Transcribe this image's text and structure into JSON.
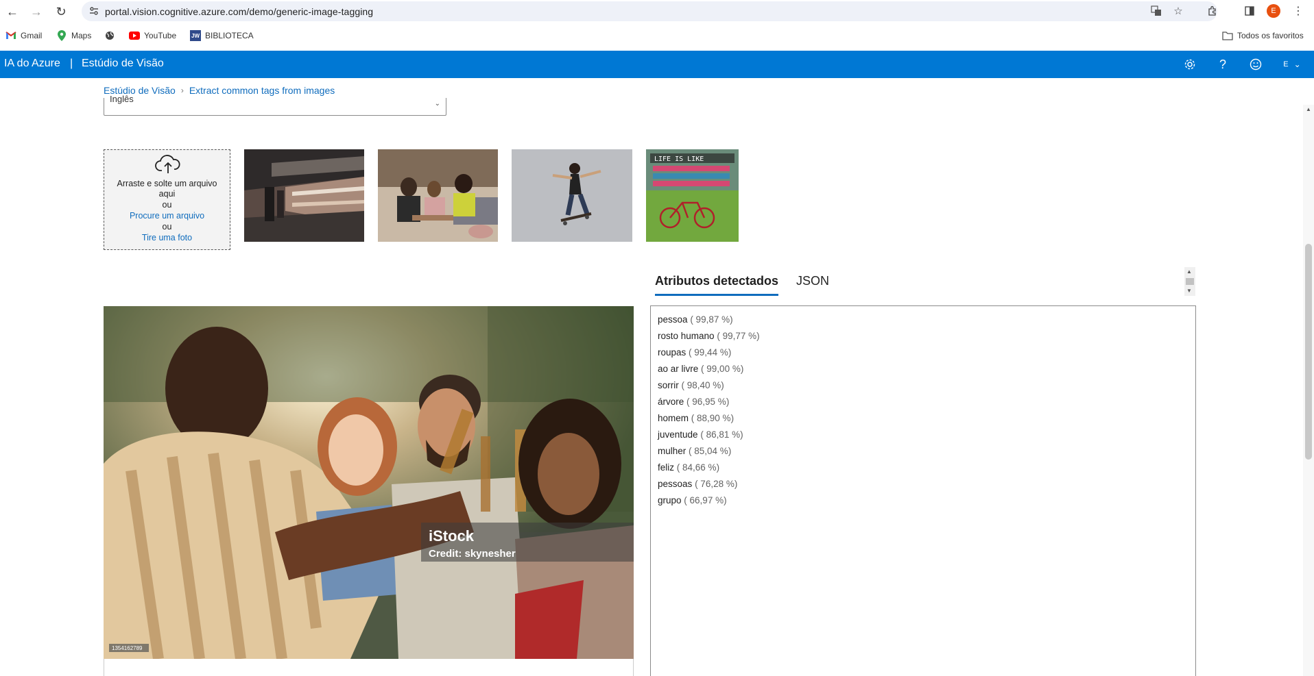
{
  "browser": {
    "url": "portal.vision.cognitive.azure.com/demo/generic-image-tagging",
    "profile_initial": "E",
    "bookmarks": [
      "Gmail",
      "Maps",
      "YouTube",
      "BIBLIOTECA"
    ],
    "all_bookmarks_label": "Todos os favoritos"
  },
  "header": {
    "brand": "IA do Azure",
    "separator": "|",
    "studio": "Estúdio de Visão",
    "user_initial": "E"
  },
  "breadcrumb": {
    "home": "Estúdio de Visão",
    "current": "Extract common tags from images"
  },
  "language_select": {
    "value": "Inglês"
  },
  "dropzone": {
    "line1": "Arraste e solte um arquivo aqui",
    "or1": "ou",
    "browse_link": "Procure um arquivo",
    "or2": "ou",
    "photo_link": "Tire uma foto"
  },
  "tabs": [
    "Atributos detectados",
    "JSON"
  ],
  "watermark": {
    "brand": "iStock",
    "credit": "Credit: skynesher",
    "image_id": "1354162789"
  },
  "tags": [
    {
      "name": "pessoa",
      "conf": "( 99,87 %)"
    },
    {
      "name": "rosto humano",
      "conf": "( 99,77 %)"
    },
    {
      "name": "roupas",
      "conf": "( 99,44 %)"
    },
    {
      "name": "ao ar livre",
      "conf": "( 99,00 %)"
    },
    {
      "name": "sorrir",
      "conf": "( 98,40 %)"
    },
    {
      "name": "árvore",
      "conf": "( 96,95 %)"
    },
    {
      "name": "homem",
      "conf": "( 88,90 %)"
    },
    {
      "name": "juventude",
      "conf": "( 86,81 %)"
    },
    {
      "name": "mulher",
      "conf": "( 85,04 %)"
    },
    {
      "name": "feliz",
      "conf": "( 84,66 %)"
    },
    {
      "name": "pessoas",
      "conf": "( 76,28 %)"
    },
    {
      "name": "grupo",
      "conf": "( 66,97 %)"
    }
  ],
  "colors": {
    "azure_blue": "#0078d4",
    "link_blue": "#0f6cbd"
  }
}
